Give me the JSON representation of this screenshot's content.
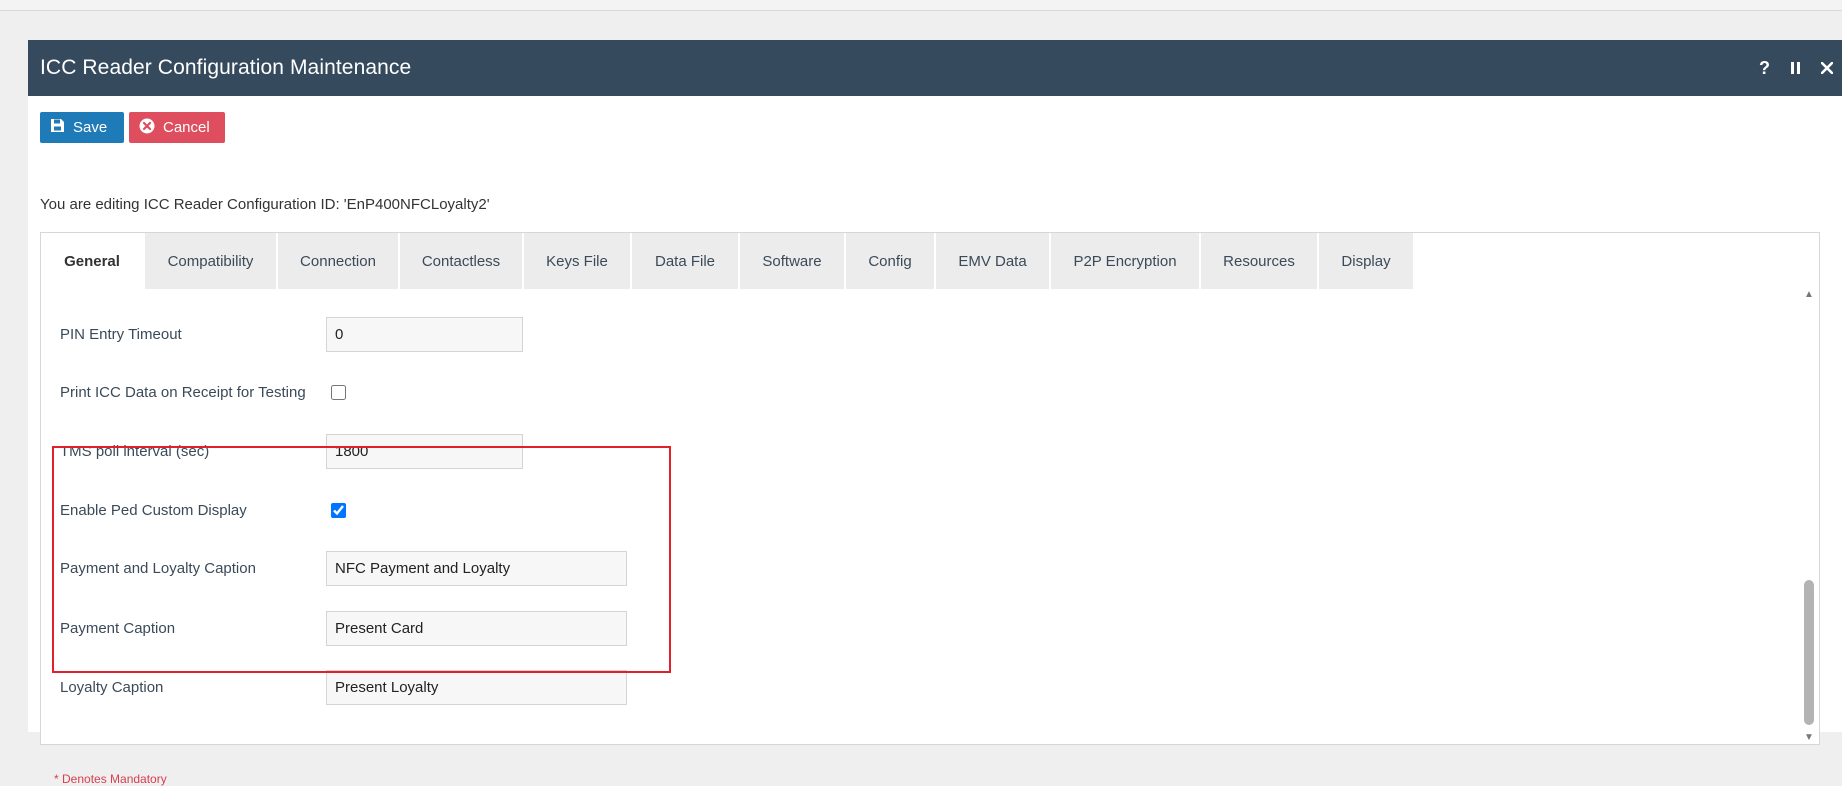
{
  "window": {
    "title": "ICC Reader Configuration Maintenance",
    "help_label": "?"
  },
  "toolbar": {
    "save_label": "Save",
    "cancel_label": "Cancel"
  },
  "edit_message": "You are editing ICC Reader Configuration ID: 'EnP400NFCLoyalty2'",
  "tabs": [
    {
      "label": "General",
      "active": true
    },
    {
      "label": "Compatibility"
    },
    {
      "label": "Connection"
    },
    {
      "label": "Contactless"
    },
    {
      "label": "Keys File"
    },
    {
      "label": "Data File"
    },
    {
      "label": "Software"
    },
    {
      "label": "Config"
    },
    {
      "label": "EMV Data"
    },
    {
      "label": "P2P Encryption"
    },
    {
      "label": "Resources"
    },
    {
      "label": "Display"
    }
  ],
  "form": {
    "pin_entry_timeout": {
      "label": "PIN Entry Timeout",
      "value": "0"
    },
    "print_icc_data": {
      "label": "Print ICC Data on Receipt for Testing",
      "checked": false
    },
    "tms_poll_interval": {
      "label": "TMS poll interval (sec)",
      "value": "1800"
    },
    "enable_ped_custom_display": {
      "label": "Enable Ped Custom Display",
      "checked": true
    },
    "payment_loyalty_caption": {
      "label": "Payment and Loyalty Caption",
      "value": "NFC Payment and Loyalty"
    },
    "payment_caption": {
      "label": "Payment Caption",
      "value": "Present Card"
    },
    "loyalty_caption": {
      "label": "Loyalty Caption",
      "value": "Present Loyalty"
    }
  },
  "mandatory_note": "* Denotes Mandatory",
  "colors": {
    "titlebar": "#364a5e",
    "save": "#1f7ab8",
    "cancel": "#de4e5f",
    "highlight": "#e0202a"
  }
}
